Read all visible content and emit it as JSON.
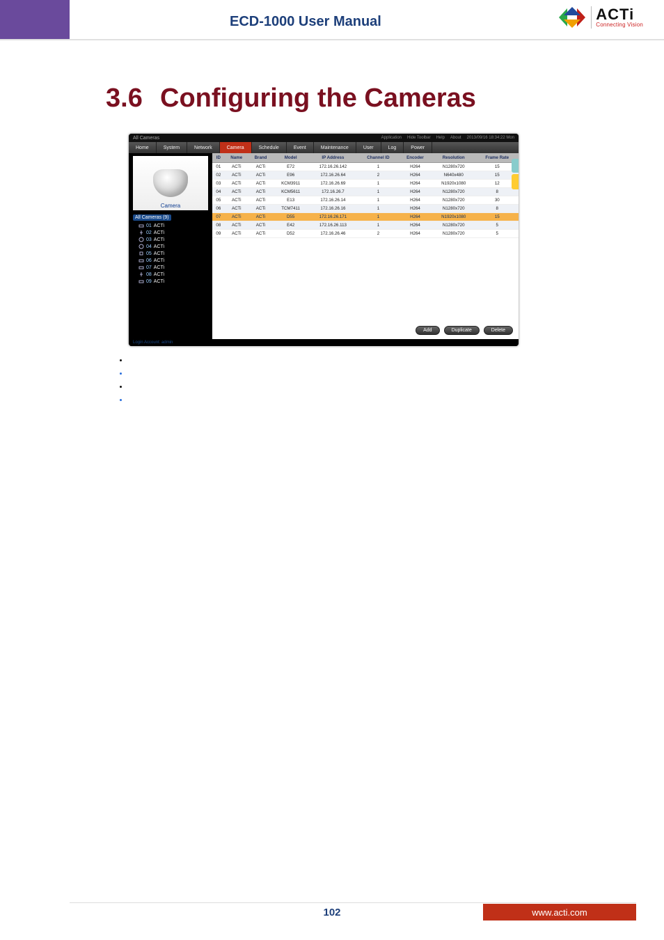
{
  "header": {
    "title": "ECD-1000 User Manual"
  },
  "logo": {
    "name": "ACTi",
    "tagline": "Connecting Vision"
  },
  "section": {
    "number": "3.6",
    "title": "Configuring the Cameras"
  },
  "app": {
    "window_title": "All Cameras",
    "top_links": {
      "application": "Application",
      "hide_toolbar": "Hide Toolbar",
      "help": "Help",
      "about": "About",
      "clock": "2013/09/16 18:34:22 Mon"
    },
    "nav": {
      "home": "Home",
      "system": "System",
      "network": "Network",
      "camera": "Camera",
      "schedule": "Schedule",
      "event": "Event",
      "maintenance": "Maintenance",
      "user": "User",
      "log": "Log",
      "power": "Power"
    },
    "active_tab": "camera",
    "sidebar": {
      "thumb_label": "Camera",
      "tree_root": "All Cameras (9)",
      "items": [
        {
          "num": "01",
          "name": "ACTi"
        },
        {
          "num": "02",
          "name": "ACTi"
        },
        {
          "num": "03",
          "name": "ACTi"
        },
        {
          "num": "04",
          "name": "ACTi"
        },
        {
          "num": "05",
          "name": "ACTi"
        },
        {
          "num": "06",
          "name": "ACTi"
        },
        {
          "num": "07",
          "name": "ACTi"
        },
        {
          "num": "08",
          "name": "ACTi"
        },
        {
          "num": "09",
          "name": "ACTi"
        }
      ]
    },
    "table": {
      "headers": {
        "id": "ID",
        "name": "Name",
        "brand": "Brand",
        "model": "Model",
        "ip": "IP Address",
        "channel": "Channel ID",
        "encoder": "Encoder",
        "resolution": "Resolution",
        "framerate": "Frame Rate"
      },
      "rows": [
        {
          "id": "01",
          "name": "ACTi",
          "brand": "ACTi",
          "model": "E72",
          "ip": "172.16.26.142",
          "channel": "1",
          "encoder": "H264",
          "resolution": "N1280x720",
          "framerate": "15"
        },
        {
          "id": "02",
          "name": "ACTi",
          "brand": "ACTi",
          "model": "E96",
          "ip": "172.16.26.64",
          "channel": "2",
          "encoder": "H264",
          "resolution": "N640x480",
          "framerate": "15"
        },
        {
          "id": "03",
          "name": "ACTi",
          "brand": "ACTi",
          "model": "KCM3911",
          "ip": "172.16.26.69",
          "channel": "1",
          "encoder": "H264",
          "resolution": "N1920x1080",
          "framerate": "12"
        },
        {
          "id": "04",
          "name": "ACTi",
          "brand": "ACTi",
          "model": "KCM5611",
          "ip": "172.16.26.7",
          "channel": "1",
          "encoder": "H264",
          "resolution": "N1280x720",
          "framerate": "8"
        },
        {
          "id": "05",
          "name": "ACTi",
          "brand": "ACTi",
          "model": "E13",
          "ip": "172.16.26.14",
          "channel": "1",
          "encoder": "H264",
          "resolution": "N1280x720",
          "framerate": "30"
        },
        {
          "id": "06",
          "name": "ACTi",
          "brand": "ACTi",
          "model": "TCM7411",
          "ip": "172.16.26.16",
          "channel": "1",
          "encoder": "H264",
          "resolution": "N1280x720",
          "framerate": "8"
        },
        {
          "id": "07",
          "name": "ACTi",
          "brand": "ACTi",
          "model": "D55",
          "ip": "172.16.26.171",
          "channel": "1",
          "encoder": "H264",
          "resolution": "N1920x1080",
          "framerate": "15",
          "selected": true
        },
        {
          "id": "08",
          "name": "ACTi",
          "brand": "ACTi",
          "model": "E42",
          "ip": "172.16.26.113",
          "channel": "1",
          "encoder": "H264",
          "resolution": "N1280x720",
          "framerate": "5"
        },
        {
          "id": "09",
          "name": "ACTi",
          "brand": "ACTi",
          "model": "D52",
          "ip": "172.16.26.46",
          "channel": "2",
          "encoder": "H264",
          "resolution": "N1280x720",
          "framerate": "5"
        }
      ]
    },
    "buttons": {
      "add": "Add",
      "duplicate": "Duplicate",
      "delete": "Delete"
    },
    "footer": "Login Account: admin"
  },
  "footer": {
    "page": "102",
    "url": "www.acti.com"
  }
}
